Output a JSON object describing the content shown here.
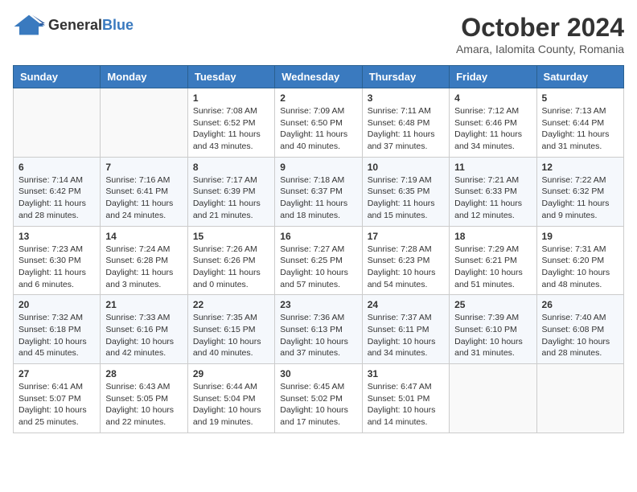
{
  "header": {
    "logo_general": "General",
    "logo_blue": "Blue",
    "month_title": "October 2024",
    "location": "Amara, Ialomita County, Romania"
  },
  "days_of_week": [
    "Sunday",
    "Monday",
    "Tuesday",
    "Wednesday",
    "Thursday",
    "Friday",
    "Saturday"
  ],
  "weeks": [
    [
      {
        "day": "",
        "info": ""
      },
      {
        "day": "",
        "info": ""
      },
      {
        "day": "1",
        "info": "Sunrise: 7:08 AM\nSunset: 6:52 PM\nDaylight: 11 hours and 43 minutes."
      },
      {
        "day": "2",
        "info": "Sunrise: 7:09 AM\nSunset: 6:50 PM\nDaylight: 11 hours and 40 minutes."
      },
      {
        "day": "3",
        "info": "Sunrise: 7:11 AM\nSunset: 6:48 PM\nDaylight: 11 hours and 37 minutes."
      },
      {
        "day": "4",
        "info": "Sunrise: 7:12 AM\nSunset: 6:46 PM\nDaylight: 11 hours and 34 minutes."
      },
      {
        "day": "5",
        "info": "Sunrise: 7:13 AM\nSunset: 6:44 PM\nDaylight: 11 hours and 31 minutes."
      }
    ],
    [
      {
        "day": "6",
        "info": "Sunrise: 7:14 AM\nSunset: 6:42 PM\nDaylight: 11 hours and 28 minutes."
      },
      {
        "day": "7",
        "info": "Sunrise: 7:16 AM\nSunset: 6:41 PM\nDaylight: 11 hours and 24 minutes."
      },
      {
        "day": "8",
        "info": "Sunrise: 7:17 AM\nSunset: 6:39 PM\nDaylight: 11 hours and 21 minutes."
      },
      {
        "day": "9",
        "info": "Sunrise: 7:18 AM\nSunset: 6:37 PM\nDaylight: 11 hours and 18 minutes."
      },
      {
        "day": "10",
        "info": "Sunrise: 7:19 AM\nSunset: 6:35 PM\nDaylight: 11 hours and 15 minutes."
      },
      {
        "day": "11",
        "info": "Sunrise: 7:21 AM\nSunset: 6:33 PM\nDaylight: 11 hours and 12 minutes."
      },
      {
        "day": "12",
        "info": "Sunrise: 7:22 AM\nSunset: 6:32 PM\nDaylight: 11 hours and 9 minutes."
      }
    ],
    [
      {
        "day": "13",
        "info": "Sunrise: 7:23 AM\nSunset: 6:30 PM\nDaylight: 11 hours and 6 minutes."
      },
      {
        "day": "14",
        "info": "Sunrise: 7:24 AM\nSunset: 6:28 PM\nDaylight: 11 hours and 3 minutes."
      },
      {
        "day": "15",
        "info": "Sunrise: 7:26 AM\nSunset: 6:26 PM\nDaylight: 11 hours and 0 minutes."
      },
      {
        "day": "16",
        "info": "Sunrise: 7:27 AM\nSunset: 6:25 PM\nDaylight: 10 hours and 57 minutes."
      },
      {
        "day": "17",
        "info": "Sunrise: 7:28 AM\nSunset: 6:23 PM\nDaylight: 10 hours and 54 minutes."
      },
      {
        "day": "18",
        "info": "Sunrise: 7:29 AM\nSunset: 6:21 PM\nDaylight: 10 hours and 51 minutes."
      },
      {
        "day": "19",
        "info": "Sunrise: 7:31 AM\nSunset: 6:20 PM\nDaylight: 10 hours and 48 minutes."
      }
    ],
    [
      {
        "day": "20",
        "info": "Sunrise: 7:32 AM\nSunset: 6:18 PM\nDaylight: 10 hours and 45 minutes."
      },
      {
        "day": "21",
        "info": "Sunrise: 7:33 AM\nSunset: 6:16 PM\nDaylight: 10 hours and 42 minutes."
      },
      {
        "day": "22",
        "info": "Sunrise: 7:35 AM\nSunset: 6:15 PM\nDaylight: 10 hours and 40 minutes."
      },
      {
        "day": "23",
        "info": "Sunrise: 7:36 AM\nSunset: 6:13 PM\nDaylight: 10 hours and 37 minutes."
      },
      {
        "day": "24",
        "info": "Sunrise: 7:37 AM\nSunset: 6:11 PM\nDaylight: 10 hours and 34 minutes."
      },
      {
        "day": "25",
        "info": "Sunrise: 7:39 AM\nSunset: 6:10 PM\nDaylight: 10 hours and 31 minutes."
      },
      {
        "day": "26",
        "info": "Sunrise: 7:40 AM\nSunset: 6:08 PM\nDaylight: 10 hours and 28 minutes."
      }
    ],
    [
      {
        "day": "27",
        "info": "Sunrise: 6:41 AM\nSunset: 5:07 PM\nDaylight: 10 hours and 25 minutes."
      },
      {
        "day": "28",
        "info": "Sunrise: 6:43 AM\nSunset: 5:05 PM\nDaylight: 10 hours and 22 minutes."
      },
      {
        "day": "29",
        "info": "Sunrise: 6:44 AM\nSunset: 5:04 PM\nDaylight: 10 hours and 19 minutes."
      },
      {
        "day": "30",
        "info": "Sunrise: 6:45 AM\nSunset: 5:02 PM\nDaylight: 10 hours and 17 minutes."
      },
      {
        "day": "31",
        "info": "Sunrise: 6:47 AM\nSunset: 5:01 PM\nDaylight: 10 hours and 14 minutes."
      },
      {
        "day": "",
        "info": ""
      },
      {
        "day": "",
        "info": ""
      }
    ]
  ]
}
